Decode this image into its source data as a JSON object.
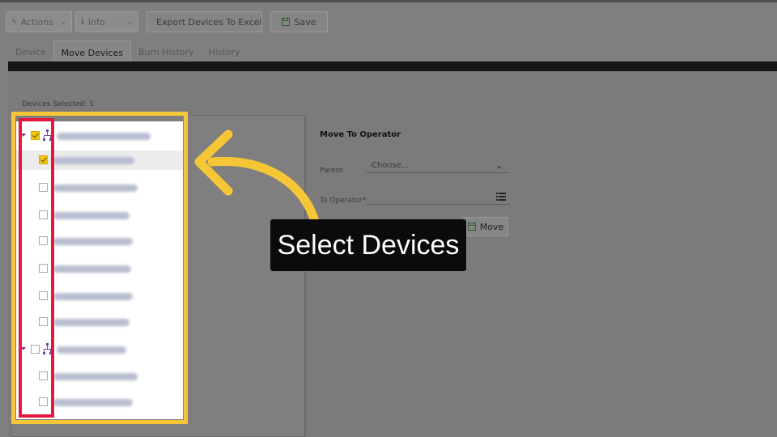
{
  "toolbar": {
    "actions_label": "Actions",
    "info_label": "Info",
    "export_label": "Export Devices To Excel",
    "save_label": "Save"
  },
  "tabs": [
    {
      "label": "Device",
      "active": false
    },
    {
      "label": "Move Devices",
      "active": true
    },
    {
      "label": "Burn History",
      "active": false
    },
    {
      "label": "History",
      "active": false
    }
  ],
  "devices_selected": "Devices Selected: 1",
  "tree": {
    "rows": [
      {
        "type": "group",
        "checked": true
      },
      {
        "type": "device",
        "checked": true,
        "selected": true
      },
      {
        "type": "device",
        "checked": false
      },
      {
        "type": "device",
        "checked": false
      },
      {
        "type": "device",
        "checked": false
      },
      {
        "type": "device",
        "checked": false
      },
      {
        "type": "device",
        "checked": false
      },
      {
        "type": "device",
        "checked": false
      },
      {
        "type": "group",
        "checked": false
      },
      {
        "type": "device",
        "checked": false
      },
      {
        "type": "device",
        "checked": false
      }
    ]
  },
  "form": {
    "title": "Move To Operator",
    "parent_label": "Parent",
    "parent_value": "Choose...",
    "to_operator_label": "To Operator*",
    "move_label": "Move"
  },
  "callout": {
    "text": "Select Devices"
  },
  "colors": {
    "highlight_yellow": "#f7c637",
    "highlight_red": "#e3183c",
    "checkbox_checked": "#f5c60b",
    "overlay_gray": "#7f7f7f"
  }
}
